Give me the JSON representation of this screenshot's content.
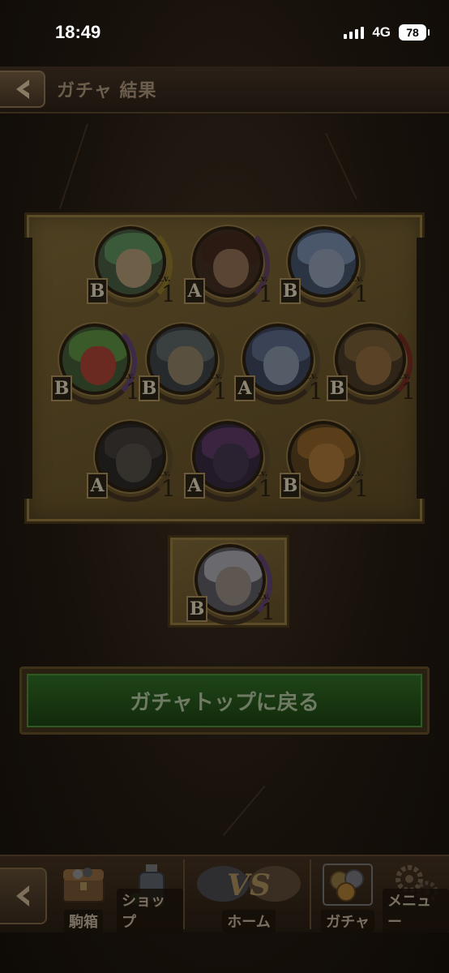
{
  "status_bar": {
    "time": "18:49",
    "network": "4G",
    "battery": "78"
  },
  "header": {
    "title": "ガチャ 結果"
  },
  "results": [
    {
      "rank": "B",
      "lv_label": "Lv.",
      "level": "1"
    },
    {
      "rank": "A",
      "lv_label": "Lv.",
      "level": "1"
    },
    {
      "rank": "B",
      "lv_label": "Lv.",
      "level": "1"
    },
    {
      "rank": "B",
      "lv_label": "Lv.",
      "level": "1"
    },
    {
      "rank": "B",
      "lv_label": "Lv.",
      "level": "1"
    },
    {
      "rank": "A",
      "lv_label": "Lv.",
      "level": "1"
    },
    {
      "rank": "B",
      "lv_label": "Lv.",
      "level": "1"
    },
    {
      "rank": "A",
      "lv_label": "Lv.",
      "level": "1"
    },
    {
      "rank": "A",
      "lv_label": "Lv.",
      "level": "1"
    },
    {
      "rank": "B",
      "lv_label": "Lv.",
      "level": "1"
    }
  ],
  "bonus": {
    "rank": "B",
    "lv_label": "Lv.",
    "level": "1"
  },
  "main_button": {
    "label": "ガチャトップに戻る"
  },
  "bottom_nav": {
    "items": [
      {
        "label": "駒箱",
        "icon": "chest-icon"
      },
      {
        "label": "ショップ",
        "icon": "shop-bottle-icon"
      },
      {
        "label": "ホーム",
        "icon": "vs-home-icon"
      },
      {
        "label": "ガチャ",
        "icon": "coins-icon"
      },
      {
        "label": "メニュー",
        "icon": "gears-icon"
      }
    ]
  },
  "colors": {
    "background": "#120d08",
    "panel": "#4a3c1f",
    "button_green": "#1f4418",
    "rank_frame": "#6a5a3a"
  }
}
